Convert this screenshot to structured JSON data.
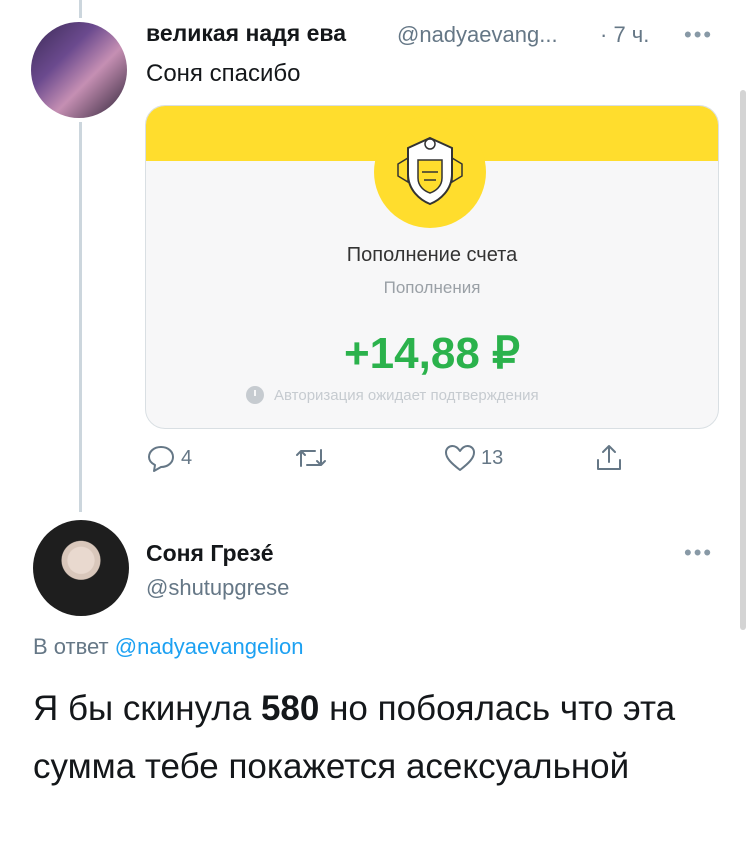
{
  "tweet1": {
    "display_name": "великая надя ева",
    "handle": "@nadyaevang...",
    "time": "· 7 ч.",
    "more": "•••",
    "text": "Соня спасибо",
    "card": {
      "title": "Пополнение счета",
      "subtitle": "Пополнения",
      "amount": "+14,88 ₽",
      "status": "Авторизация ожидает подтверждения"
    },
    "actions": {
      "reply_count": "4",
      "retweet_count": "",
      "like_count": "13"
    }
  },
  "tweet2": {
    "display_name": "Соня Грезé",
    "handle": "@shutupgrese",
    "more": "•••",
    "reply_prefix": "В ответ",
    "reply_handle": "@nadyaevangelion",
    "text_before": "Я бы скинула ",
    "text_bold": "580",
    "text_after": " но побоялась что эта сумма тебе покажется асексуальной"
  },
  "colors": {
    "link": "#1da1f2",
    "bank_yellow": "#ffdd2d",
    "amount_green": "#2bb24c",
    "muted": "#657786"
  }
}
